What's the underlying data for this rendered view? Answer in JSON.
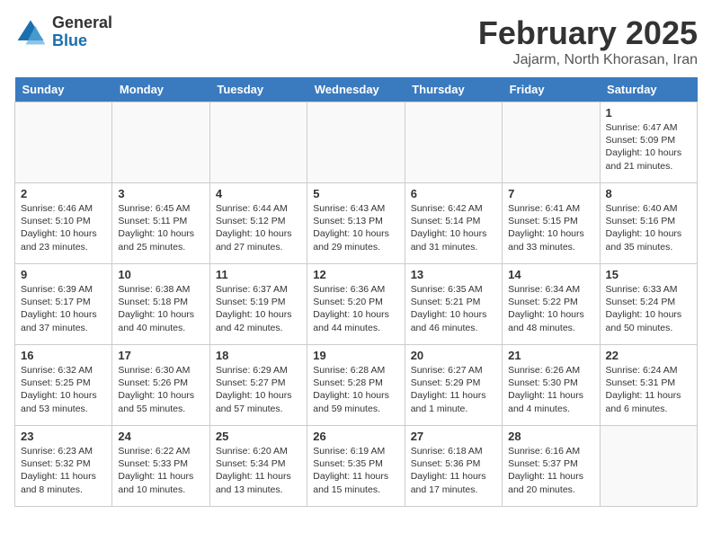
{
  "logo": {
    "general": "General",
    "blue": "Blue"
  },
  "title": "February 2025",
  "subtitle": "Jajarm, North Khorasan, Iran",
  "days_of_week": [
    "Sunday",
    "Monday",
    "Tuesday",
    "Wednesday",
    "Thursday",
    "Friday",
    "Saturday"
  ],
  "weeks": [
    [
      {
        "day": "",
        "info": ""
      },
      {
        "day": "",
        "info": ""
      },
      {
        "day": "",
        "info": ""
      },
      {
        "day": "",
        "info": ""
      },
      {
        "day": "",
        "info": ""
      },
      {
        "day": "",
        "info": ""
      },
      {
        "day": "1",
        "info": "Sunrise: 6:47 AM\nSunset: 5:09 PM\nDaylight: 10 hours and 21 minutes."
      }
    ],
    [
      {
        "day": "2",
        "info": "Sunrise: 6:46 AM\nSunset: 5:10 PM\nDaylight: 10 hours and 23 minutes."
      },
      {
        "day": "3",
        "info": "Sunrise: 6:45 AM\nSunset: 5:11 PM\nDaylight: 10 hours and 25 minutes."
      },
      {
        "day": "4",
        "info": "Sunrise: 6:44 AM\nSunset: 5:12 PM\nDaylight: 10 hours and 27 minutes."
      },
      {
        "day": "5",
        "info": "Sunrise: 6:43 AM\nSunset: 5:13 PM\nDaylight: 10 hours and 29 minutes."
      },
      {
        "day": "6",
        "info": "Sunrise: 6:42 AM\nSunset: 5:14 PM\nDaylight: 10 hours and 31 minutes."
      },
      {
        "day": "7",
        "info": "Sunrise: 6:41 AM\nSunset: 5:15 PM\nDaylight: 10 hours and 33 minutes."
      },
      {
        "day": "8",
        "info": "Sunrise: 6:40 AM\nSunset: 5:16 PM\nDaylight: 10 hours and 35 minutes."
      }
    ],
    [
      {
        "day": "9",
        "info": "Sunrise: 6:39 AM\nSunset: 5:17 PM\nDaylight: 10 hours and 37 minutes."
      },
      {
        "day": "10",
        "info": "Sunrise: 6:38 AM\nSunset: 5:18 PM\nDaylight: 10 hours and 40 minutes."
      },
      {
        "day": "11",
        "info": "Sunrise: 6:37 AM\nSunset: 5:19 PM\nDaylight: 10 hours and 42 minutes."
      },
      {
        "day": "12",
        "info": "Sunrise: 6:36 AM\nSunset: 5:20 PM\nDaylight: 10 hours and 44 minutes."
      },
      {
        "day": "13",
        "info": "Sunrise: 6:35 AM\nSunset: 5:21 PM\nDaylight: 10 hours and 46 minutes."
      },
      {
        "day": "14",
        "info": "Sunrise: 6:34 AM\nSunset: 5:22 PM\nDaylight: 10 hours and 48 minutes."
      },
      {
        "day": "15",
        "info": "Sunrise: 6:33 AM\nSunset: 5:24 PM\nDaylight: 10 hours and 50 minutes."
      }
    ],
    [
      {
        "day": "16",
        "info": "Sunrise: 6:32 AM\nSunset: 5:25 PM\nDaylight: 10 hours and 53 minutes."
      },
      {
        "day": "17",
        "info": "Sunrise: 6:30 AM\nSunset: 5:26 PM\nDaylight: 10 hours and 55 minutes."
      },
      {
        "day": "18",
        "info": "Sunrise: 6:29 AM\nSunset: 5:27 PM\nDaylight: 10 hours and 57 minutes."
      },
      {
        "day": "19",
        "info": "Sunrise: 6:28 AM\nSunset: 5:28 PM\nDaylight: 10 hours and 59 minutes."
      },
      {
        "day": "20",
        "info": "Sunrise: 6:27 AM\nSunset: 5:29 PM\nDaylight: 11 hours and 1 minute."
      },
      {
        "day": "21",
        "info": "Sunrise: 6:26 AM\nSunset: 5:30 PM\nDaylight: 11 hours and 4 minutes."
      },
      {
        "day": "22",
        "info": "Sunrise: 6:24 AM\nSunset: 5:31 PM\nDaylight: 11 hours and 6 minutes."
      }
    ],
    [
      {
        "day": "23",
        "info": "Sunrise: 6:23 AM\nSunset: 5:32 PM\nDaylight: 11 hours and 8 minutes."
      },
      {
        "day": "24",
        "info": "Sunrise: 6:22 AM\nSunset: 5:33 PM\nDaylight: 11 hours and 10 minutes."
      },
      {
        "day": "25",
        "info": "Sunrise: 6:20 AM\nSunset: 5:34 PM\nDaylight: 11 hours and 13 minutes."
      },
      {
        "day": "26",
        "info": "Sunrise: 6:19 AM\nSunset: 5:35 PM\nDaylight: 11 hours and 15 minutes."
      },
      {
        "day": "27",
        "info": "Sunrise: 6:18 AM\nSunset: 5:36 PM\nDaylight: 11 hours and 17 minutes."
      },
      {
        "day": "28",
        "info": "Sunrise: 6:16 AM\nSunset: 5:37 PM\nDaylight: 11 hours and 20 minutes."
      },
      {
        "day": "",
        "info": ""
      }
    ]
  ]
}
